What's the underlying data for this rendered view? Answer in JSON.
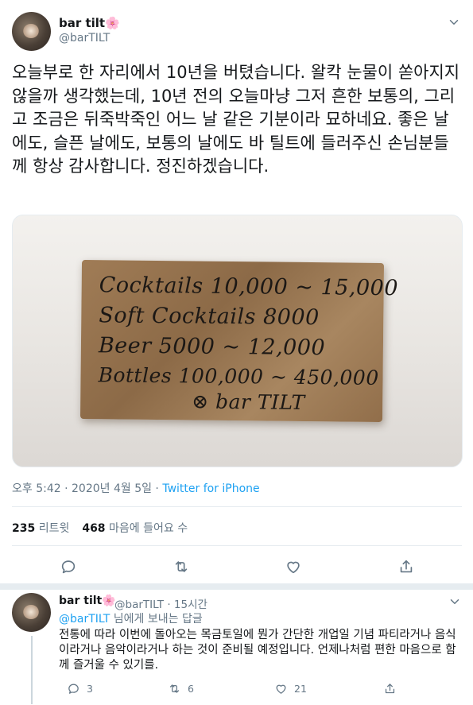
{
  "tweet": {
    "display_name": "bar tilt🌸",
    "handle": "@barTILT",
    "text": "오늘부로 한 자리에서 10년을 버텼습니다. 왈칵 눈물이 쏟아지지 않을까 생각했는데, 10년 전의 오늘마냥 그저 흔한 보통의, 그리고 조금은 뒤죽박죽인 어느 날 같은 기분이라 묘하네요. 좋은 날에도, 슬픈 날에도, 보통의 날에도 바 틸트에 들러주신 손님분들께 항상 감사합니다. 정진하겠습니다.",
    "photo_text": [
      "Cocktails 10,000 ~ 15,000",
      "Soft Cocktails  8000",
      "Beer  5000 ~ 12,000",
      "Bottles 100,000 ~ 450,000",
      "⊗ bar TILT"
    ],
    "timestamp": "오후 5:42 · 2020년 4월 5일 · ",
    "source": "Twitter for iPhone",
    "retweets_count": "235",
    "retweets_label": "리트윗",
    "likes_count": "468",
    "likes_label": "마음에 들어요 수"
  },
  "reply": {
    "display_name": "bar tilt🌸",
    "handle_time": "@barTILT · 15시간",
    "reply_to_handle": "@barTILT",
    "reply_to_suffix": " 님에게 보내는 답글",
    "text": "전통에 따라 이번에 돌아오는 목금토일에 뭔가 간단한 개업일 기념 파티라거나 음식이라거나 음악이라거나 하는 것이 준비될 예정입니다. 언제나처럼 편한 마음으로 함께 즐거울 수 있기를.",
    "reply_count": "3",
    "retweet_count": "6",
    "like_count": "21"
  },
  "colors": {
    "accent": "#1da1f2",
    "secondary_text": "#657786",
    "divider": "#e6ecf0"
  },
  "icons": [
    "chevron-down-icon",
    "reply-icon",
    "retweet-icon",
    "like-icon",
    "share-icon"
  ]
}
